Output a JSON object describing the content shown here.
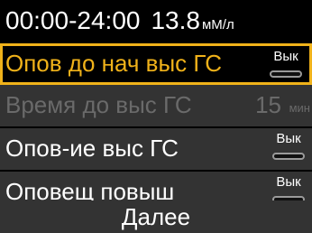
{
  "header": {
    "time_range": "00:00-24:00",
    "glucose_value": "13.8",
    "glucose_unit": "мМ/л"
  },
  "menu": {
    "items": [
      {
        "label": "Опов до нач выс ГС",
        "toggle_label": "Вык",
        "state": "selected"
      },
      {
        "label": "Время до выс ГС",
        "value": "15",
        "unit": "мин",
        "state": "disabled"
      },
      {
        "label": "Опов-ие выс ГС",
        "toggle_label": "Вык",
        "state": "normal"
      },
      {
        "label": "Оповещ повыш",
        "toggle_label": "Вык",
        "state": "normal"
      }
    ]
  },
  "footer": {
    "next_label": "Далее"
  },
  "colors": {
    "selection": "#f0b21a",
    "row_background": "#333333",
    "disabled_text": "#6a6a6a"
  }
}
